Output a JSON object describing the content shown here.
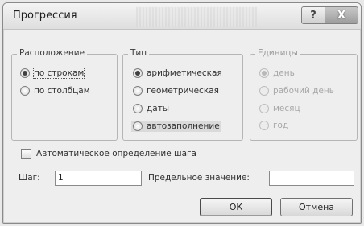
{
  "window": {
    "title": "Прогрессия",
    "help_glyph": "?",
    "close_glyph": "X"
  },
  "location": {
    "legend": "Расположение",
    "options": [
      {
        "label": "по строкам",
        "checked": true
      },
      {
        "label": "по столбцам",
        "checked": false
      }
    ]
  },
  "type": {
    "legend": "Тип",
    "options": [
      {
        "label": "арифметическая",
        "checked": true
      },
      {
        "label": "геометрическая",
        "checked": false
      },
      {
        "label": "даты",
        "checked": false
      },
      {
        "label": "автозаполнение",
        "checked": false
      }
    ]
  },
  "units": {
    "legend": "Единицы",
    "options": [
      {
        "label": "день",
        "checked": true
      },
      {
        "label": "рабочий день",
        "checked": false
      },
      {
        "label": "месяц",
        "checked": false
      },
      {
        "label": "год",
        "checked": false
      }
    ]
  },
  "auto_step": {
    "label": "Автоматическое определение шага",
    "checked": false
  },
  "step": {
    "label": "Шаг:",
    "value": "1"
  },
  "limit": {
    "label": "Предельное значение:",
    "value": ""
  },
  "buttons": {
    "ok": "ОК",
    "cancel": "Отмена"
  }
}
